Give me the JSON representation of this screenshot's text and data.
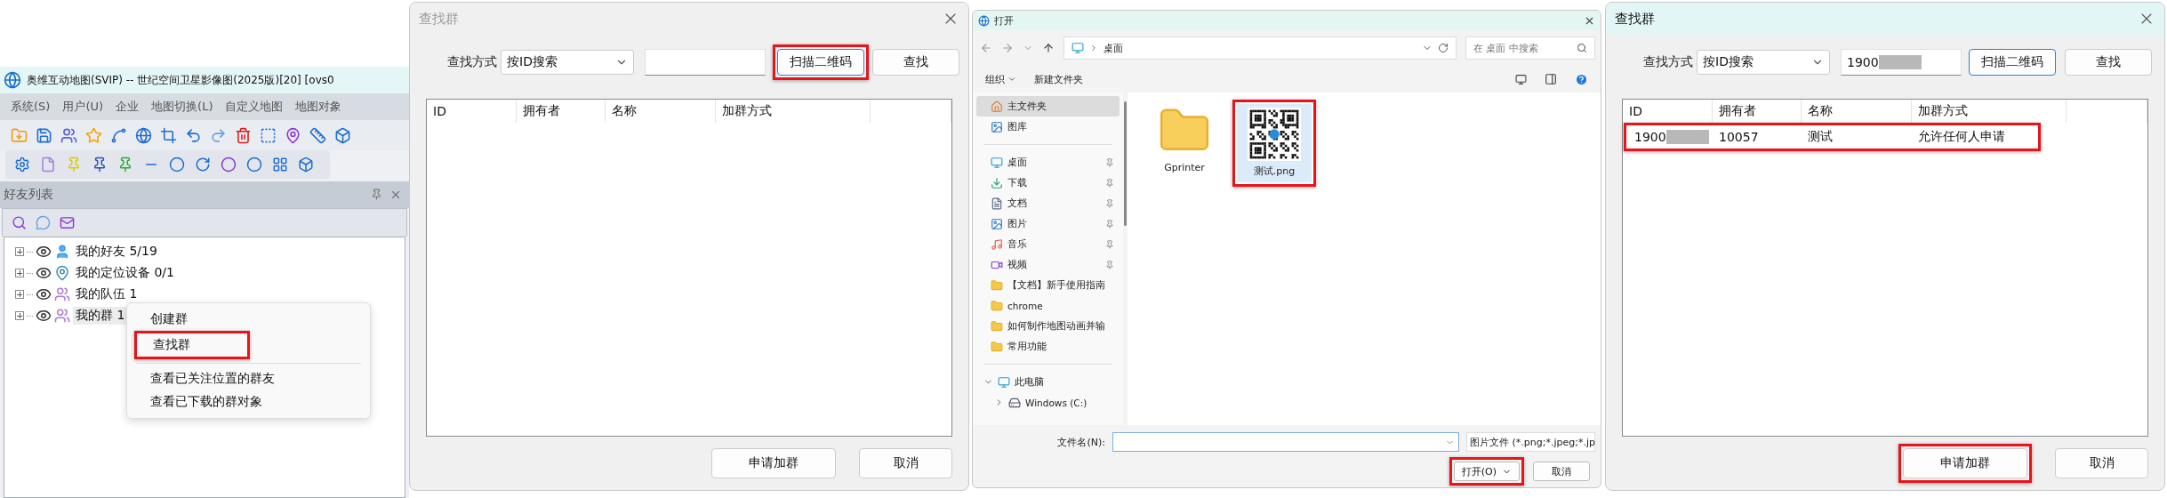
{
  "app_window": {
    "title": "奥维互动地图(SVIP) -- 世纪空间卫星影像图(2025版)[20] [ovs0",
    "menu": [
      "系统(S)",
      "用户(U)",
      "企业",
      "地图切换(L)",
      "自定义地图",
      "地图对象"
    ],
    "friend_panel": {
      "title": "好友列表",
      "tree": [
        {
          "label": "我的好友 5/19",
          "kind": "person",
          "selected": false
        },
        {
          "label": "我的定位设备 0/1",
          "kind": "device",
          "selected": false
        },
        {
          "label": "我的队伍 1",
          "kind": "team",
          "selected": false
        },
        {
          "label": "我的群 1",
          "kind": "team",
          "selected": true
        }
      ],
      "context_menu": [
        [
          {
            "label": "创建群",
            "highlighted": false
          },
          {
            "label": "查找群",
            "highlighted": true
          }
        ],
        [
          {
            "label": "查看已关注位置的群友",
            "highlighted": false
          },
          {
            "label": "查看已下载的群对象",
            "highlighted": false
          }
        ]
      ]
    }
  },
  "find_group_dialog": {
    "title": "查找群",
    "active": false,
    "method_label": "查找方式",
    "method_value": "按ID搜索",
    "scan_button": {
      "label": "扫描二维码",
      "highlighted": true
    },
    "find_button": {
      "label": "查找"
    },
    "columns": [
      "ID",
      "拥有者",
      "名称",
      "加群方式"
    ],
    "apply_button": {
      "label": "申请加群",
      "highlighted": false
    },
    "cancel_button": {
      "label": "取消"
    }
  },
  "open_file_dialog": {
    "title": "打开",
    "active": true,
    "path": "桌面",
    "search_placeholder": "在 桌面 中搜索",
    "commands": [
      "组织",
      "新建文件夹"
    ],
    "sidebar_sections": [
      [
        {
          "label": "主文件夹",
          "kind": "home",
          "pinned": false,
          "selected": true
        },
        {
          "label": "图库",
          "kind": "gallery",
          "pinned": false,
          "selected": false
        }
      ],
      [
        {
          "label": "桌面",
          "kind": "desktop",
          "pinned": true,
          "selected": false
        },
        {
          "label": "下载",
          "kind": "download",
          "pinned": true,
          "selected": false
        },
        {
          "label": "文档",
          "kind": "document",
          "pinned": true,
          "selected": false
        },
        {
          "label": "图片",
          "kind": "picture",
          "pinned": true,
          "selected": false
        },
        {
          "label": "音乐",
          "kind": "music",
          "pinned": true,
          "selected": false
        },
        {
          "label": "视频",
          "kind": "video",
          "pinned": true,
          "selected": false
        },
        {
          "label": "【文档】新手使用指南",
          "kind": "folder",
          "pinned": false,
          "selected": false
        },
        {
          "label": "chrome",
          "kind": "folder",
          "pinned": false,
          "selected": false
        },
        {
          "label": "如何制作地图动画并输",
          "kind": "folder",
          "pinned": false,
          "selected": false
        },
        {
          "label": "常用功能",
          "kind": "folder",
          "pinned": false,
          "selected": false
        }
      ]
    ],
    "this_pc": {
      "label": "此电脑",
      "expanded": true,
      "children": [
        {
          "label": "Windows (C:)",
          "expanded": false
        }
      ]
    },
    "files": [
      {
        "name": "Gprinter",
        "kind": "folder",
        "selected": false,
        "highlighted": false
      },
      {
        "name": "测试.png",
        "kind": "qr-image",
        "selected": true,
        "highlighted": true
      }
    ],
    "filename_label": "文件名(N):",
    "file_type": "图片文件 (*.png;*.jpeg;*.jp",
    "open_button": {
      "label": "打开(O)",
      "highlighted": true
    },
    "cancel_button": {
      "label": "取消"
    }
  },
  "find_group_result_dialog": {
    "title": "查找群",
    "active": true,
    "method_label": "查找方式",
    "method_value": "按ID搜索",
    "query": {
      "value": "1900",
      "redacted": true
    },
    "scan_button": {
      "label": "扫描二维码",
      "highlighted": false
    },
    "find_button": {
      "label": "查找"
    },
    "columns": [
      "ID",
      "拥有者",
      "名称",
      "加群方式"
    ],
    "rows": [
      {
        "highlighted": true,
        "cells": [
          {
            "text": "1900",
            "redacted": true
          },
          {
            "text": "10057",
            "redacted": false
          },
          {
            "text": "测试",
            "redacted": false
          },
          {
            "text": "允许任何人申请",
            "redacted": false
          }
        ]
      }
    ],
    "apply_button": {
      "label": "申请加群",
      "highlighted": true
    },
    "cancel_button": {
      "label": "取消"
    }
  }
}
